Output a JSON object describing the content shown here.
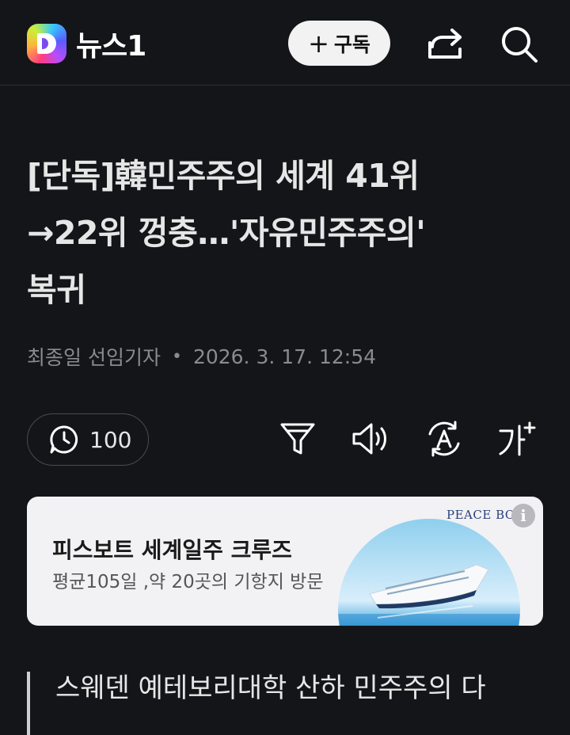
{
  "header": {
    "logo_text": "뉴스1",
    "subscribe_plus": "+",
    "subscribe_label": "구독",
    "icons": [
      "share-icon",
      "search-icon"
    ]
  },
  "article": {
    "headline_lines": [
      "[단독]韓민주주의 세계 41위",
      "→22위 껑충…'자유민주주의'",
      "복귀"
    ],
    "reporter": "최종일 선임기자",
    "separator": "•",
    "date": "2026. 3. 17. 12:54",
    "count": "100"
  },
  "toolbar": {
    "icons": [
      "clock-comment-icon",
      "filter-icon",
      "speaker-icon",
      "translate-icon",
      "font-size-icon"
    ]
  },
  "ad": {
    "title": "피스보트 세계일주 크루즈",
    "subtitle": "평균105일 ,약 20곳의 기항지 방문",
    "brand": "PEACE BOAT",
    "info": "i"
  },
  "quote": {
    "text": "스웨덴 예테보리대학 산하 민주주의 다"
  }
}
